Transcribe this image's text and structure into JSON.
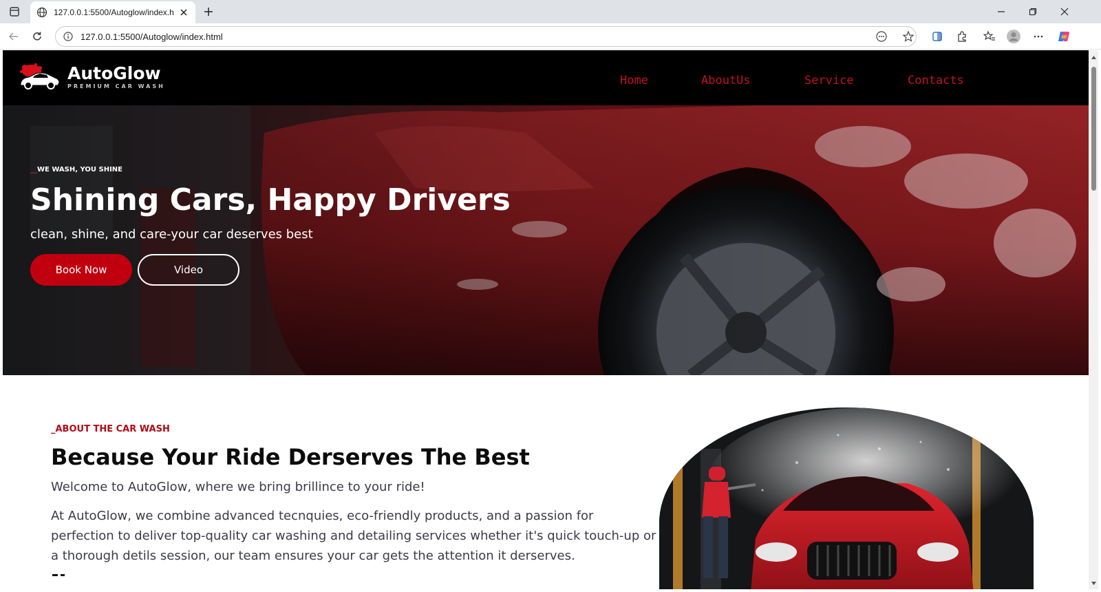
{
  "browser": {
    "tab_title": "127.0.0.1:5500/Autoglow/index.html",
    "url": "127.0.0.1:5500/Autoglow/index.html"
  },
  "site": {
    "brand_name": "AutoGlow",
    "brand_tagline": "PREMIUM CAR WASH",
    "nav": [
      "Home",
      "AboutUs",
      "Service",
      "Contacts"
    ],
    "accent_color": "#c1000f"
  },
  "hero": {
    "tagline_dash": "__",
    "tagline": "WE WASH, YOU SHINE",
    "title": "Shining Cars, Happy Drivers",
    "subtitle": "clean, shine, and care-your car deserves best",
    "book_label": "Book Now",
    "video_label": "Video"
  },
  "about": {
    "label": "_ABOUT THE CAR WASH",
    "title": "Because Your Ride Derserves The Best",
    "lead": "Welcome to AutoGlow, where we bring brillince to your ride!",
    "body": "At AutoGlow, we combine advanced tecnquies, eco-friendly products, and a passion for perfection to deliver top-quality car washing and detailing services whether it's quick touch-up or a thorough detils session, our team ensures your car gets the attention it derserves."
  }
}
